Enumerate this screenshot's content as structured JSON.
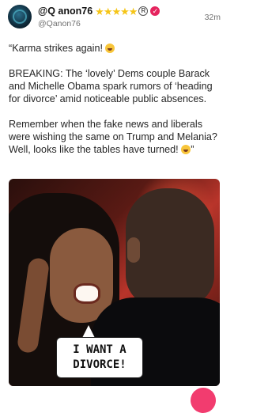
{
  "post": {
    "display_name": "@Q anon76",
    "handle": "@Qanon76",
    "timestamp": "32m",
    "rating_stars": 5,
    "paragraphs": [
      "“Karma strikes again!",
      "BREAKING: The ‘lovely’ Dems couple Barack and Michelle Obama spark rumors of ‘heading for divorce’ amid noticeable public absences.",
      "Remember when the fake news and liberals were wishing the same on Trump and Melania? Well, looks like the tables have turned!",
      "”"
    ]
  },
  "image": {
    "speech_bubble_line1": "I WANT A",
    "speech_bubble_line2": "DIVORCE!"
  },
  "colors": {
    "accent": "#e5245e",
    "star": "#f5c518",
    "fab": "#f23c6f"
  },
  "icons": {
    "verified": "verified-badge-icon",
    "registered": "registered-mark-icon",
    "emoji": "laughing-face-emoji-icon"
  }
}
